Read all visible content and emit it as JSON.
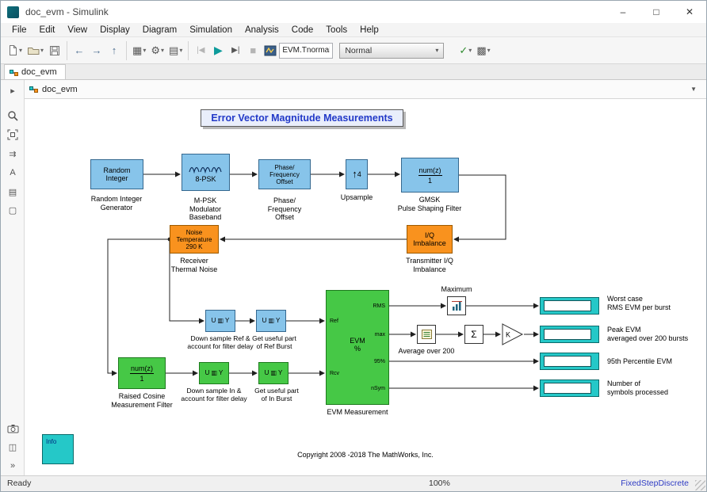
{
  "window": {
    "title": "doc_evm - Simulink"
  },
  "menu": [
    "File",
    "Edit",
    "View",
    "Display",
    "Diagram",
    "Simulation",
    "Analysis",
    "Code",
    "Tools",
    "Help"
  ],
  "toolbar": {
    "sim_stop_time": "EVM.Tnormal",
    "sim_mode": "Normal"
  },
  "tab": {
    "label": "doc_evm"
  },
  "breadcrumb": {
    "path": "doc_evm"
  },
  "status": {
    "ready": "Ready",
    "zoom": "100%",
    "solver": "FixedStepDiscrete"
  },
  "icons": {
    "caret": "▾",
    "minimize": "–",
    "maximize": "□",
    "close": "✕",
    "back": "←",
    "forward": "→",
    "up": "↑",
    "library": "▦",
    "gear": "⚙",
    "config": "▤",
    "step_back": "|◀",
    "run": "▶",
    "step_forward": "▶|",
    "stop": "■",
    "check": "✓",
    "build": "▩",
    "palette_collapse": "▸",
    "palette_shortcuts": "⇉",
    "palette_annotation": "A",
    "palette_image": "▤",
    "palette_area": "▢",
    "palette_split": "◫",
    "palette_more": "»",
    "selector": "▥",
    "upsample_arrow": "↑",
    "breadcrumb_dropdown": "▼"
  },
  "canvas": {
    "title_annotation": "Error Vector Magnitude Measurements",
    "copyright": "Copyright 2008 -2018 The MathWorks, Inc.",
    "blocks": {
      "random_integer": {
        "text": [
          "Random",
          "Integer"
        ],
        "label": [
          "Random Integer",
          "Generator"
        ]
      },
      "mpsk": {
        "text": "8-PSK",
        "label": [
          "M-PSK",
          "Modulator",
          "Baseband"
        ]
      },
      "phase_offset": {
        "text": [
          "Phase/",
          "Frequency",
          "Offset"
        ],
        "label": [
          "Phase/",
          "Frequency",
          "Offset"
        ]
      },
      "upsample": {
        "factor": "4",
        "label": [
          "Upsample"
        ]
      },
      "gmsk": {
        "numerator": "num(z)",
        "denominator": "1",
        "label": [
          "GMSK",
          "Pulse Shaping Filter"
        ]
      },
      "thermal_noise": {
        "text": [
          "Noise",
          "Temperature",
          "290 K"
        ],
        "label": [
          "Receiver",
          "Thermal Noise"
        ]
      },
      "iq_imbalance": {
        "text": [
          "I/Q",
          "Imbalance"
        ],
        "label": [
          "Transmitter I/Q",
          "Imbalance"
        ]
      },
      "downsample_ref": {
        "in": "U",
        "out": "Y",
        "label": [
          "Down sample Ref &",
          "account for filter delay"
        ]
      },
      "ref_burst": {
        "in": "U",
        "out": "Y",
        "label": [
          "Get useful part",
          "of Ref Burst"
        ]
      },
      "raised_cosine": {
        "numerator": "num(z)",
        "denominator": "1",
        "label": [
          "Raised Cosine",
          "Measurement Filter"
        ]
      },
      "downsample_in": {
        "in": "U",
        "out": "Y",
        "label": [
          "Down sample In &",
          "account for filter delay"
        ]
      },
      "in_burst": {
        "in": "U",
        "out": "Y",
        "label": [
          "Get useful part",
          "of In Burst"
        ]
      },
      "evm": {
        "center": [
          "EVM",
          "%"
        ],
        "ports": {
          "ref": "Ref",
          "rcv": "Rcv",
          "rms": "RMS",
          "max": "max",
          "p95": "95%",
          "nsym": "nSym"
        },
        "label": "EVM Measurement"
      },
      "maximum": {
        "label": "Maximum"
      },
      "average": {
        "label": "Average over 200"
      },
      "sum": {
        "symbol": "Σ"
      },
      "gain": {
        "symbol": "K"
      },
      "display_rms": {
        "label": [
          "Worst case",
          "RMS EVM per burst"
        ]
      },
      "display_peak": {
        "label": [
          "Peak EVM",
          "averaged over 200 bursts"
        ]
      },
      "display_p95": {
        "label": [
          "95th Percentile EVM"
        ]
      },
      "display_nsym": {
        "label": [
          "Number of",
          "symbols processed"
        ]
      },
      "info": {
        "text": "Info"
      }
    }
  },
  "colors": {
    "block_blue": "#87C4EA",
    "block_orange": "#F9921E",
    "block_green": "#46C846",
    "block_teal": "#25C8C8",
    "annotation_blue": "#2239C8"
  }
}
